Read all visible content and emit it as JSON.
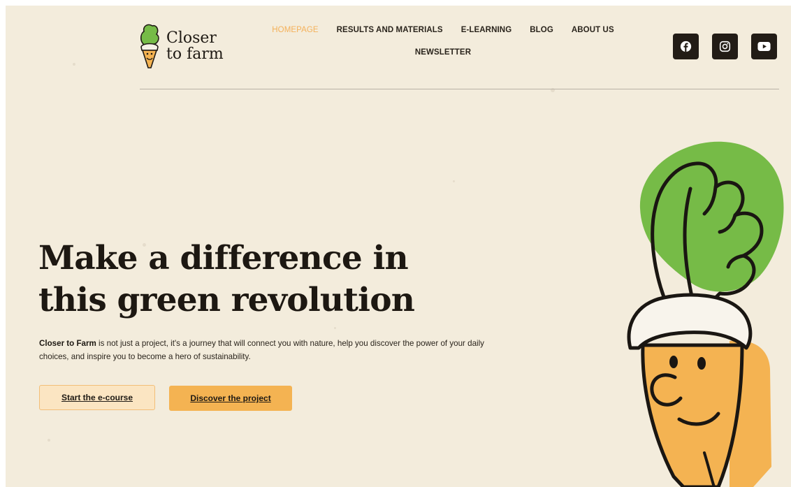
{
  "logo": {
    "line1": "Closer",
    "line2": "to farm"
  },
  "nav": {
    "items": [
      {
        "label": "HOMEPAGE",
        "active": true
      },
      {
        "label": "RESULTS AND MATERIALS",
        "active": false
      },
      {
        "label": "E-LEARNING",
        "active": false
      },
      {
        "label": "BLOG",
        "active": false
      },
      {
        "label": "ABOUT US",
        "active": false
      },
      {
        "label": "NEWSLETTER",
        "active": false
      }
    ]
  },
  "social": [
    "facebook-icon",
    "instagram-icon",
    "youtube-icon"
  ],
  "hero": {
    "title_line1": "Make a difference in",
    "title_line2": "this green revolution",
    "text_bold": "Closer to Farm",
    "text_rest": " is not just a project, it's a journey that will connect you with nature, help you discover the power of your daily choices, and inspire you to become a hero of sustainability.",
    "btn_primary": "Start the e-course",
    "btn_secondary": "Discover the project"
  },
  "colors": {
    "background": "#f3ecdc",
    "accent_orange": "#f4b352",
    "leaf_green": "#76bb47",
    "dark": "#221c16"
  }
}
